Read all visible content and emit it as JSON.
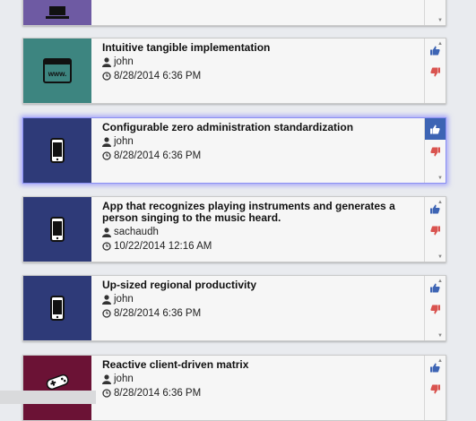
{
  "cards": [
    {
      "title": "",
      "author": "",
      "date": "",
      "color": "#6e5aa3",
      "icon": "laptop-icon",
      "selected": false
    },
    {
      "title": "Intuitive tangible implementation",
      "author": "john",
      "date": "8/28/2014 6:36 PM",
      "color": "#3d8580",
      "icon": "www-browser-icon",
      "selected": false
    },
    {
      "title": "Configurable zero administration standardization",
      "author": "john",
      "date": "8/28/2014 6:36 PM",
      "color": "#2e3a78",
      "icon": "smartphone-icon",
      "selected": true
    },
    {
      "title": "App that recognizes playing instruments and generates a person singing to the music heard.",
      "author": "sachaudh",
      "date": "10/22/2014 12:16 AM",
      "color": "#2e3a78",
      "icon": "smartphone-icon",
      "selected": false
    },
    {
      "title": "Up-sized regional productivity",
      "author": "john",
      "date": "8/28/2014 6:36 PM",
      "color": "#2e3a78",
      "icon": "smartphone-icon",
      "selected": false
    },
    {
      "title": "Reactive client-driven matrix",
      "author": "john",
      "date": "8/28/2014 6:36 PM",
      "color": "#6b1235",
      "icon": "gamepad-icon",
      "selected": false
    }
  ],
  "colors": {
    "upvote": "#3d64b4",
    "downvote": "#d9534f",
    "selected_glow": "#8a8ff2"
  }
}
